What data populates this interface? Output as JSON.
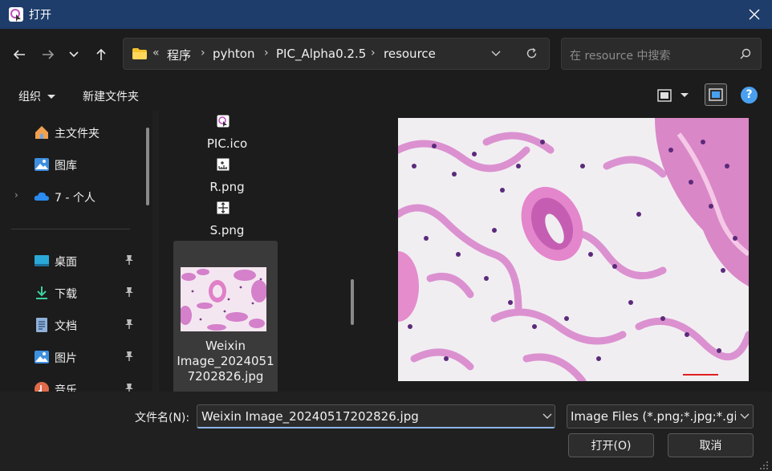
{
  "window": {
    "title": "打开",
    "close_icon": "close-icon"
  },
  "nav": {
    "breadcrumbs": [
      "程序",
      "pyhton",
      "PIC_Alpha0.2.5",
      "resource"
    ],
    "overflow": "«",
    "search_placeholder": "在 resource 中搜索"
  },
  "command_bar": {
    "organize": "组织",
    "new_folder": "新建文件夹",
    "help": "?"
  },
  "sidebar": {
    "top": [
      {
        "label": "主文件夹",
        "icon": "home-icon"
      },
      {
        "label": "图库",
        "icon": "gallery-icon"
      },
      {
        "label": "7 - 个人",
        "icon": "onedrive-cloud-icon"
      }
    ],
    "pinned": [
      {
        "label": "桌面",
        "icon": "desktop-icon"
      },
      {
        "label": "下载",
        "icon": "download-icon"
      },
      {
        "label": "文档",
        "icon": "document-icon"
      },
      {
        "label": "图片",
        "icon": "pictures-icon"
      },
      {
        "label": "音乐",
        "icon": "music-icon"
      }
    ]
  },
  "files": {
    "items": [
      {
        "name": "PIC.ico"
      },
      {
        "name": "R.png"
      },
      {
        "name": "S.png"
      }
    ],
    "selected": {
      "name_lines": [
        "Weixin",
        "Image_2024051",
        "7202826.jpg"
      ]
    }
  },
  "bottom": {
    "filename_label": "文件名(N):",
    "filename_value": "Weixin Image_20240517202826.jpg",
    "file_type": "Image Files (*.png;*.jpg;*.gif;",
    "open_button": "打开(O)",
    "cancel_button": "取消"
  },
  "colors": {
    "titlebar": "#1f3d6b",
    "accent": "#4aa0f0",
    "tissue_pink": "#d070c0"
  }
}
